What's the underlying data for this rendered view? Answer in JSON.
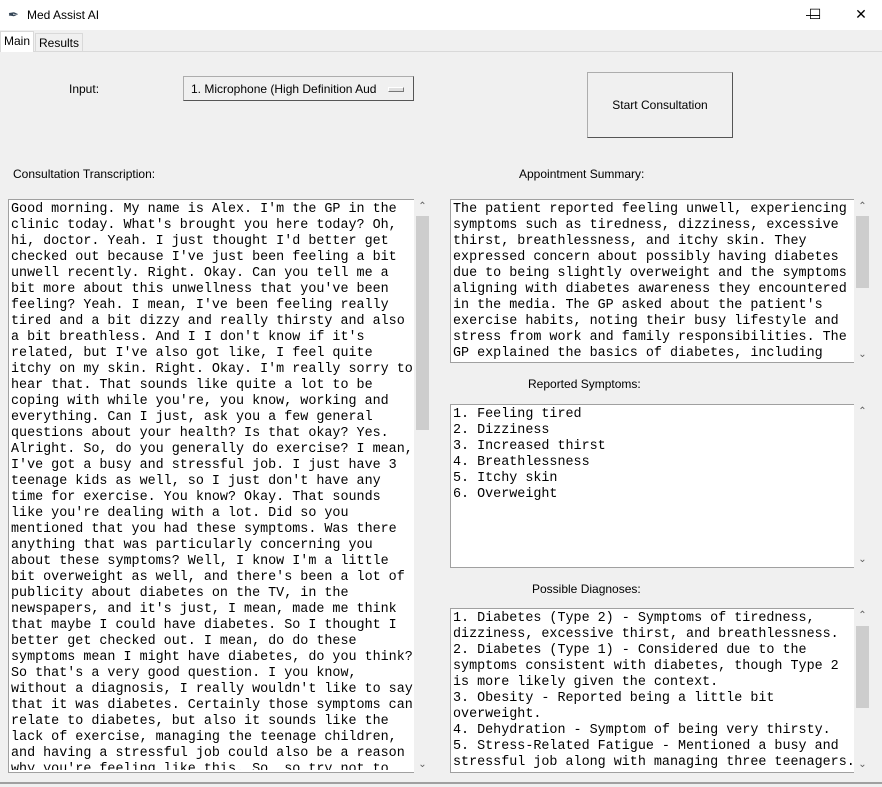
{
  "window": {
    "title": "Med Assist AI",
    "icon": "feather-icon",
    "controls": {
      "minimize": "—",
      "maximize": "☐",
      "close": "✕"
    }
  },
  "tabs": [
    {
      "label": "Main",
      "active": true
    },
    {
      "label": "Results",
      "active": false
    }
  ],
  "input": {
    "label": "Input:",
    "selected": "1. Microphone (High Definition Aud"
  },
  "start_button": "Start Consultation",
  "transcription": {
    "label": "Consultation Transcription:",
    "text": "Good morning. My name is Alex. I'm the GP in the\nclinic today. What's brought you here today? Oh,\nhi, doctor. Yeah. I just thought I'd better get\nchecked out because I've just been feeling a bit\nunwell recently. Right. Okay. Can you tell me a\nbit more about this unwellness that you've been\nfeeling? Yeah. I mean, I've been feeling really\ntired and a bit dizzy and really thirsty and also\na bit breathless. And I I don't know if it's\nrelated, but I've also got like, I feel quite\nitchy on my skin. Right. Okay. I'm really sorry to\nhear that. That sounds like quite a lot to be\ncoping with while you're, you know, working and\neverything. Can I just, ask you a few general\nquestions about your health? Is that okay? Yes.\nAlright. So, do you generally do exercise? I mean,\nI've got a busy and stressful job. I just have 3\nteenage kids as well, so I just don't have any\ntime for exercise. You know? Okay. That sounds\nlike you're dealing with a lot. Did so you\nmentioned that you had these symptoms. Was there\nanything that was particularly concerning you\nabout these symptoms? Well, I know I'm a little\nbit overweight as well, and there's been a lot of\npublicity about diabetes on the TV, in the\nnewspapers, and it's just, I mean, made me think\nthat maybe I could have diabetes. So I thought I\nbetter get checked out. I mean, do do these\nsymptoms mean I might have diabetes, do you think?\nSo that's a very good question. I you know,\nwithout a diagnosis, I really wouldn't like to say\nthat it was diabetes. Certainly those symptoms can\nrelate to diabetes, but also it sounds like the\nlack of exercise, managing the teenage children,\nand having a stressful job could also be a reason\nwhy you're feeling like this. So, so try not to"
  },
  "summary": {
    "label": "Appointment Summary:",
    "text": "The patient reported feeling unwell, experiencing\nsymptoms such as tiredness, dizziness, excessive\nthirst, breathlessness, and itchy skin. They\nexpressed concern about possibly having diabetes\ndue to being slightly overweight and the symptoms\naligning with diabetes awareness they encountered\nin the media. The GP asked about the patient's\nexercise habits, noting their busy lifestyle and\nstress from work and family responsibilities. The\nGP explained the basics of diabetes, including"
  },
  "symptoms": {
    "label": "Reported Symptoms:",
    "text": "1. Feeling tired\n2. Dizziness\n3. Increased thirst\n4. Breathlessness\n5. Itchy skin\n6. Overweight"
  },
  "diagnoses": {
    "label": "Possible Diagnoses:",
    "text": "1. Diabetes (Type 2) - Symptoms of tiredness,\ndizziness, excessive thirst, and breathlessness.\n2. Diabetes (Type 1) - Considered due to the\nsymptoms consistent with diabetes, though Type 2\nis more likely given the context.\n3. Obesity - Reported being a little bit\noverweight.\n4. Dehydration - Symptom of being very thirsty.\n5. Stress-Related Fatigue - Mentioned a busy and\nstressful job along with managing three teenagers."
  }
}
